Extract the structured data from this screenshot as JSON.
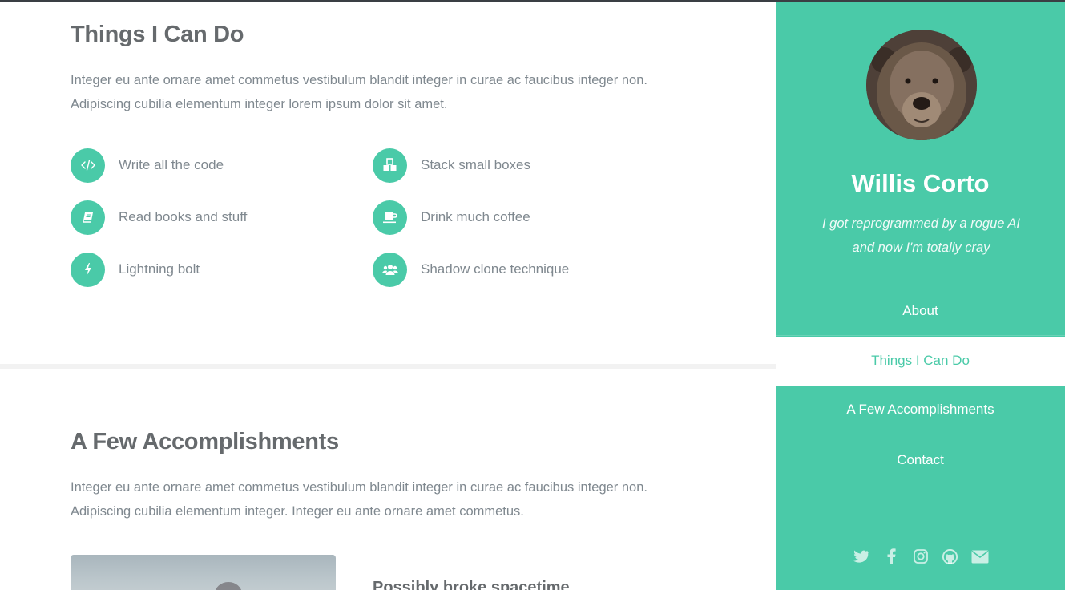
{
  "section_skills": {
    "title": "Things I Can Do",
    "text": "Integer eu ante ornare amet commetus vestibulum blandit integer in curae ac faucibus integer non. Adipiscing cubilia elementum integer lorem ipsum dolor sit amet.",
    "features": [
      {
        "label": "Write all the code",
        "icon": "code-icon"
      },
      {
        "label": "Stack small boxes",
        "icon": "cubes-icon"
      },
      {
        "label": "Read books and stuff",
        "icon": "book-icon"
      },
      {
        "label": "Drink much coffee",
        "icon": "coffee-icon"
      },
      {
        "label": "Lightning bolt",
        "icon": "bolt-icon"
      },
      {
        "label": "Shadow clone technique",
        "icon": "users-icon"
      }
    ]
  },
  "section_accomplishments": {
    "title": "A Few Accomplishments",
    "text": "Integer eu ante ornare amet commetus vestibulum blandit integer in curae ac faucibus integer non. Adipiscing cubilia elementum integer. Integer eu ante ornare amet commetus.",
    "first_item_title": "Possibly broke spacetime"
  },
  "sidebar": {
    "name": "Willis Corto",
    "bio_line1": "I got reprogrammed by a rogue AI",
    "bio_line2": "and now I'm totally cray",
    "nav": [
      {
        "label": "About",
        "active": false
      },
      {
        "label": "Things I Can Do",
        "active": true
      },
      {
        "label": "A Few Accomplishments",
        "active": false
      },
      {
        "label": "Contact",
        "active": false
      }
    ],
    "socials": [
      "twitter-icon",
      "facebook-icon",
      "instagram-icon",
      "github-icon",
      "email-icon"
    ]
  },
  "colors": {
    "accent": "#4acaa8",
    "heading": "#666a6d",
    "body_text": "#7f888f",
    "topbar": "#3a3f44",
    "divider": "#f2f2f2"
  }
}
